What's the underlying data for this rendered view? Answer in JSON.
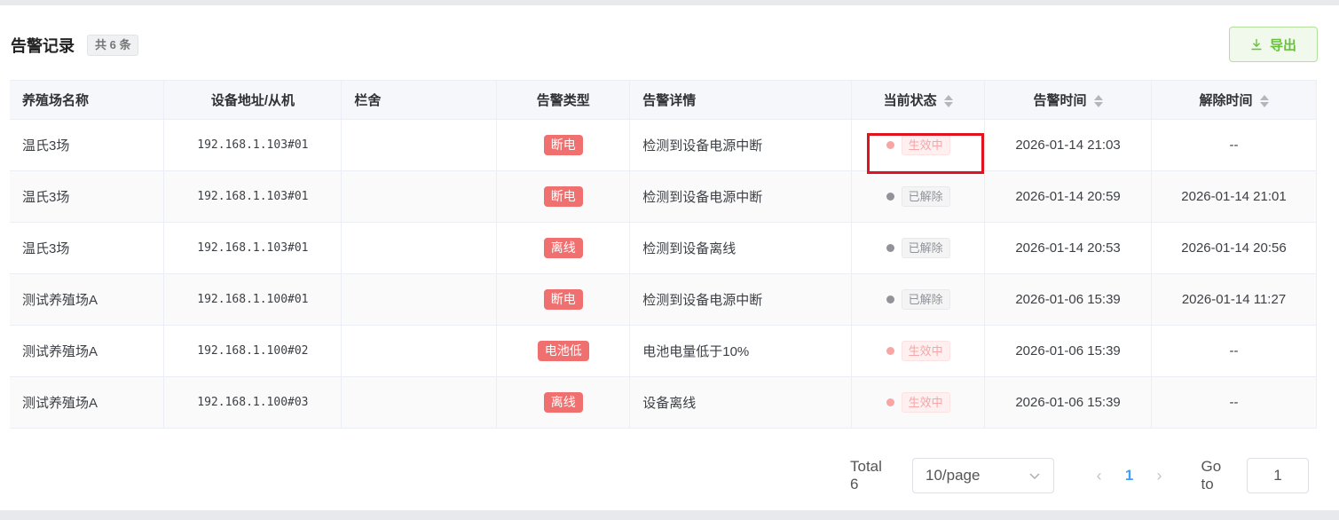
{
  "header": {
    "title": "告警记录",
    "count_badge": "共 6 条",
    "export_label": "导出"
  },
  "table": {
    "columns": [
      "养殖场名称",
      "设备地址/从机",
      "栏舍",
      "告警类型",
      "告警详情",
      "当前状态",
      "告警时间",
      "解除时间"
    ],
    "rows": [
      {
        "farm": "温氏3场",
        "address": "192.168.1.103#01",
        "pen": "",
        "type": "断电",
        "detail": "检测到设备电源中断",
        "status": "生效中",
        "status_kind": "active",
        "alarm_time": "2026-01-14 21:03",
        "release_time": "--"
      },
      {
        "farm": "温氏3场",
        "address": "192.168.1.103#01",
        "pen": "",
        "type": "断电",
        "detail": "检测到设备电源中断",
        "status": "已解除",
        "status_kind": "resolved",
        "alarm_time": "2026-01-14 20:59",
        "release_time": "2026-01-14 21:01"
      },
      {
        "farm": "温氏3场",
        "address": "192.168.1.103#01",
        "pen": "",
        "type": "离线",
        "detail": "检测到设备离线",
        "status": "已解除",
        "status_kind": "resolved",
        "alarm_time": "2026-01-14 20:53",
        "release_time": "2026-01-14 20:56"
      },
      {
        "farm": "测试养殖场A",
        "address": "192.168.1.100#01",
        "pen": "",
        "type": "断电",
        "detail": "检测到设备电源中断",
        "status": "已解除",
        "status_kind": "resolved",
        "alarm_time": "2026-01-06 15:39",
        "release_time": "2026-01-14 11:27"
      },
      {
        "farm": "测试养殖场A",
        "address": "192.168.1.100#02",
        "pen": "",
        "type": "电池低",
        "detail": "电池电量低于10%",
        "status": "生效中",
        "status_kind": "active",
        "alarm_time": "2026-01-06 15:39",
        "release_time": "--"
      },
      {
        "farm": "测试养殖场A",
        "address": "192.168.1.100#03",
        "pen": "",
        "type": "离线",
        "detail": "设备离线",
        "status": "生效中",
        "status_kind": "active",
        "alarm_time": "2026-01-06 15:39",
        "release_time": "--"
      }
    ]
  },
  "pagination": {
    "total_label": "Total 6",
    "page_size": "10/page",
    "current_page": "1",
    "goto_label": "Go to",
    "goto_value": "1"
  },
  "colors": {
    "accent": "#409eff",
    "danger": "#f06f6f",
    "success": "#67c23a",
    "address": "#d8a254",
    "highlight": "#e0141e"
  }
}
